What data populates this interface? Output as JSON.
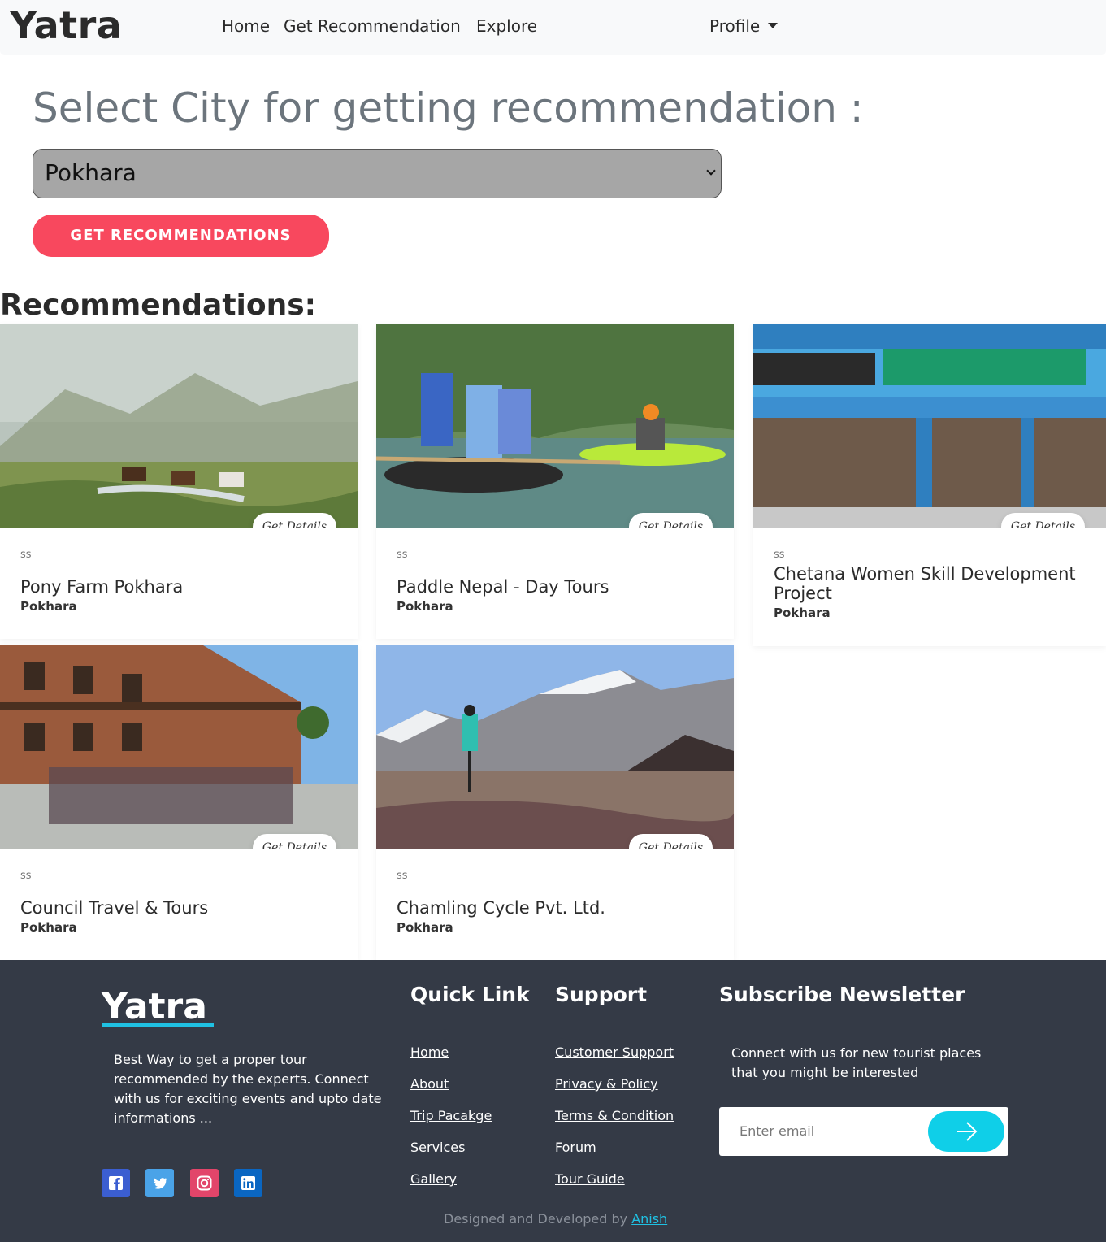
{
  "navbar": {
    "brand": "Yatra",
    "home": "Home",
    "get_recommendation": "Get Recommendation",
    "explore": "Explore",
    "profile": "Profile"
  },
  "select_section": {
    "title": "Select City for getting recommendation :",
    "selected_city": "Pokhara",
    "button_label": "GET RECOMMENDATIONS"
  },
  "recommendations": {
    "heading": "Recommendations:",
    "details_label": "Get Details",
    "cards": [
      {
        "category": "ss",
        "title": "Pony Farm Pokhara",
        "city": "Pokhara"
      },
      {
        "category": "ss",
        "title": "Paddle Nepal - Day Tours",
        "city": "Pokhara"
      },
      {
        "category": "ss",
        "title": "Chetana Women Skill Development Project",
        "city": "Pokhara"
      },
      {
        "category": "ss",
        "title": "Council Travel & Tours",
        "city": "Pokhara"
      },
      {
        "category": "ss",
        "title": "Chamling Cycle Pvt. Ltd.",
        "city": "Pokhara"
      }
    ]
  },
  "footer": {
    "brand": "Yatra",
    "description": "Best Way to get a proper tour recommended by the experts. Connect with us for exciting events and upto date informations ...",
    "quick_link": {
      "title": "Quick Link",
      "links": [
        "Home",
        "About",
        "Trip Pacakge",
        "Services",
        "Gallery"
      ]
    },
    "support": {
      "title": "Support",
      "links": [
        "Customer Support",
        "Privacy & Policy",
        "Terms & Condition",
        "Forum",
        "Tour Guide"
      ]
    },
    "newsletter": {
      "title": "Subscribe Newsletter",
      "text": "Connect with us for new tourist places that you might be interested",
      "email_placeholder": "Enter email"
    },
    "social_icons": [
      "facebook-icon",
      "twitter-icon",
      "instagram-icon",
      "linkedin-icon"
    ],
    "credit_prefix": "Designed and Developed by",
    "credit_name": "Anish"
  },
  "colors": {
    "accent_button": "#f8485e",
    "footer_bg": "#343a46",
    "footer_accent": "#1fc1e3",
    "select_bg": "#a6a6a6"
  }
}
